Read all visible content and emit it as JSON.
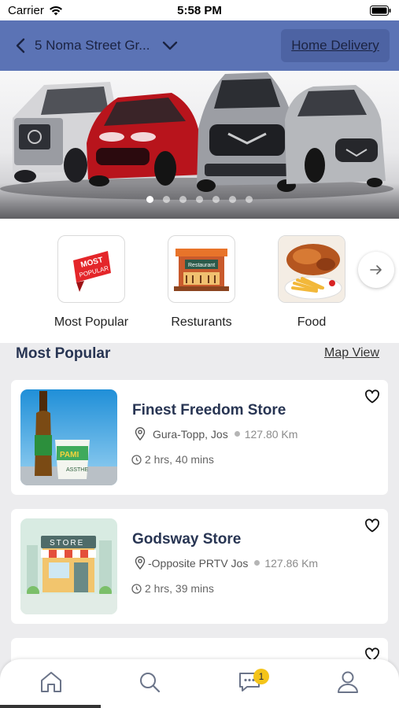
{
  "status_bar": {
    "carrier": "Carrier",
    "time": "5:58 PM"
  },
  "header": {
    "address": "5 Noma Street Gr...",
    "delivery_label": "Home Delivery",
    "bg_color": "#5b73b5"
  },
  "banner": {
    "slide_count": 7,
    "active_slide": 1
  },
  "categories": [
    {
      "label": "Most Popular",
      "icon": "most-popular-ribbon-icon"
    },
    {
      "label": "Resturants",
      "icon": "restaurant-storefront-icon"
    },
    {
      "label": "Food",
      "icon": "roast-chicken-fries-icon"
    }
  ],
  "section": {
    "title": "Most Popular",
    "map_link": "Map View"
  },
  "stores": [
    {
      "name": "Finest Freedom Store",
      "location": "Gura-Topp, Jos",
      "distance": "127.80 Km",
      "eta": "2 hrs, 40 mins",
      "image": "beer-bottle-and-cup-icon"
    },
    {
      "name": "Godsway Store",
      "location": "-Opposite PRTV Jos",
      "distance": "127.86 Km",
      "eta": "2 hrs, 39 mins",
      "image": "store-front-icon"
    }
  ],
  "tabbar": {
    "items": [
      "home-icon",
      "search-icon",
      "chat-icon",
      "profile-icon"
    ],
    "chat_badge": "1"
  }
}
